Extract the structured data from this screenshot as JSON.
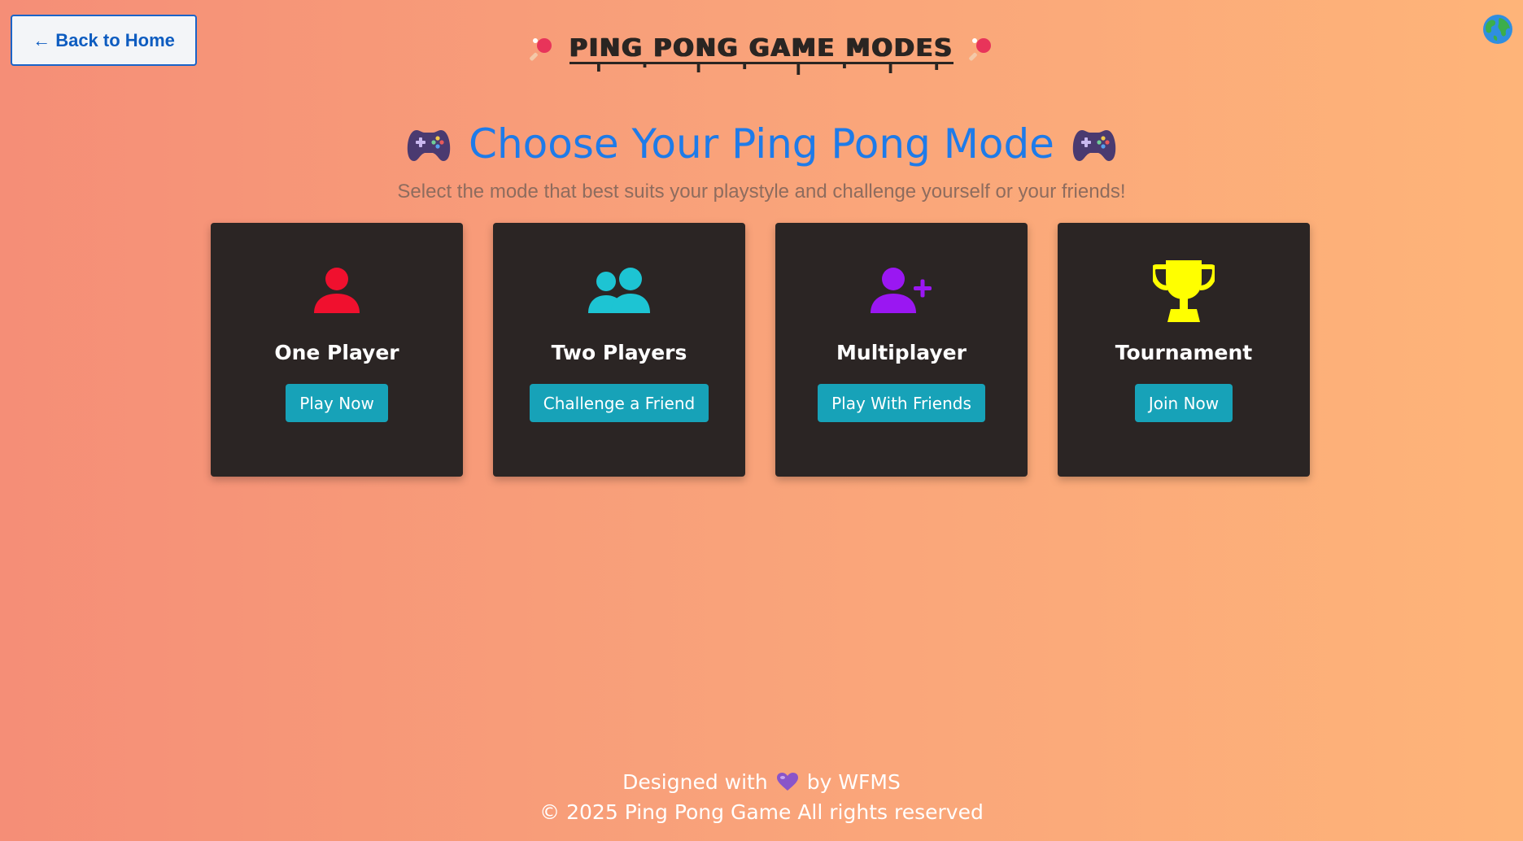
{
  "nav": {
    "back_label": "← Back to Home"
  },
  "brand": {
    "title": "PING PONG GAME MODES"
  },
  "main": {
    "heading": "Choose Your Ping Pong Mode",
    "subtitle": "Select the mode that best suits your playstyle and challenge yourself or your friends!"
  },
  "modes": [
    {
      "title": "One Player",
      "button": "Play Now",
      "icon": "user-icon",
      "color": "#f0102e"
    },
    {
      "title": "Two Players",
      "button": "Challenge a Friend",
      "icon": "users-icon",
      "color": "#1dc4d3"
    },
    {
      "title": "Multiplayer",
      "button": "Play With Friends",
      "icon": "user-plus-icon",
      "color": "#9a17f2"
    },
    {
      "title": "Tournament",
      "button": "Join Now",
      "icon": "trophy-icon",
      "color": "#ffff00"
    }
  ],
  "footer": {
    "designed_prefix": "Designed with",
    "designed_suffix": "by WFMS",
    "copyright": "© 2025 Ping Pong Game All rights reserved"
  },
  "colors": {
    "accent": "#1e7be9",
    "button": "#17a2b8",
    "card": "#2b2524"
  }
}
